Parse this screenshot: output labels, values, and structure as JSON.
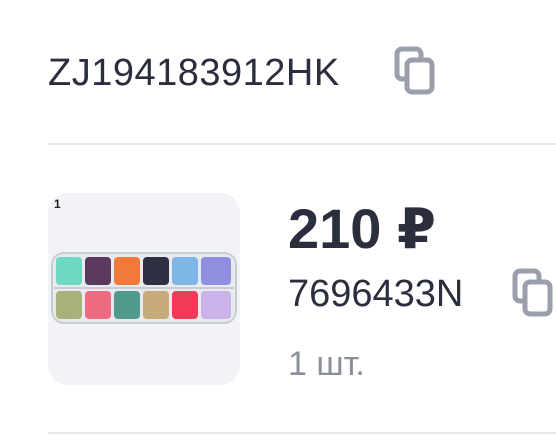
{
  "tracking": {
    "number": "ZJ194183912HK",
    "copy_icon": "copy-icon"
  },
  "item": {
    "thumbnail_badge": "1",
    "price": "210 ₽",
    "sku": "7696433N",
    "quantity": "1 шт.",
    "copy_icon": "copy-icon"
  },
  "colors": {
    "text": "#2a2e3d",
    "muted": "#8a8f9c",
    "icon": "#9a9fab",
    "divider": "#e6e8ee",
    "thumb_bg": "#f2f3f6"
  }
}
